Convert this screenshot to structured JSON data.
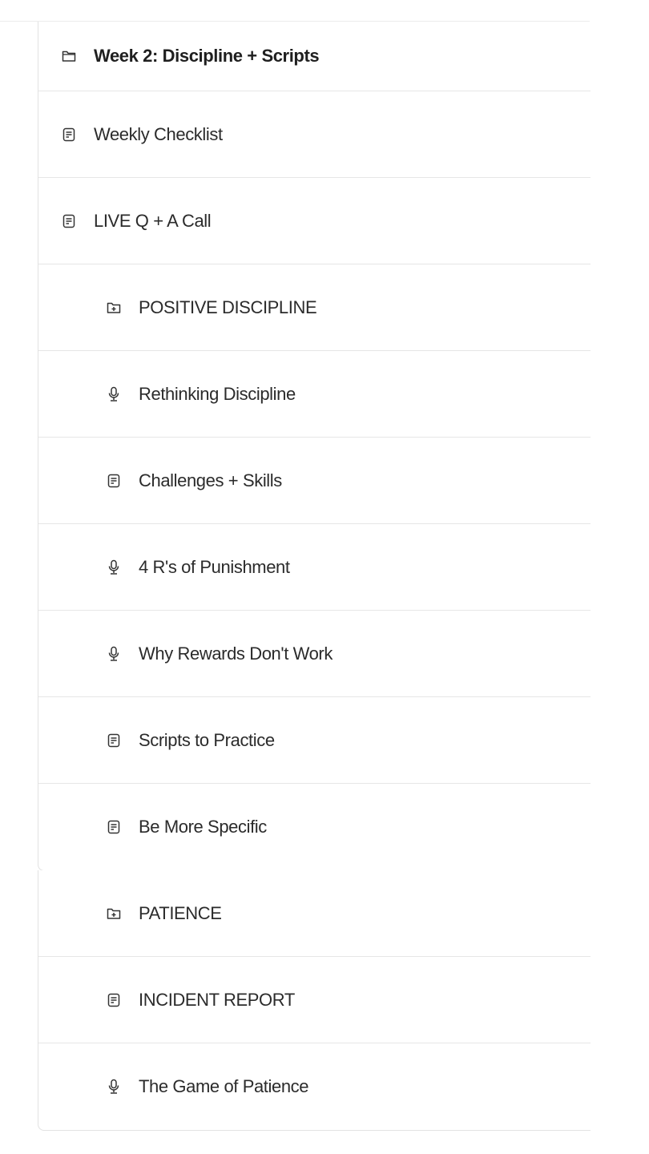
{
  "module": {
    "title": "Week 2: Discipline + Scripts",
    "icon": "folder-icon"
  },
  "items": [
    {
      "label": "Weekly Checklist",
      "icon": "document-icon"
    },
    {
      "label": "LIVE Q + A Call",
      "icon": "document-icon"
    },
    {
      "label": "POSITIVE DISCIPLINE",
      "icon": "folder-plus-icon"
    },
    {
      "label": "Rethinking Discipline",
      "icon": "microphone-icon"
    },
    {
      "label": "Challenges + Skills",
      "icon": "document-icon"
    },
    {
      "label": "4 R's of Punishment",
      "icon": "microphone-icon"
    },
    {
      "label": "Why Rewards Don't Work",
      "icon": "microphone-icon"
    },
    {
      "label": "Scripts to Practice",
      "icon": "document-icon"
    },
    {
      "label": "Be More Specific",
      "icon": "document-icon"
    }
  ],
  "section2": {
    "items": [
      {
        "label": "PATIENCE",
        "icon": "folder-plus-icon"
      },
      {
        "label": "INCIDENT REPORT",
        "icon": "document-icon"
      },
      {
        "label": "The Game of Patience",
        "icon": "microphone-icon"
      }
    ]
  }
}
